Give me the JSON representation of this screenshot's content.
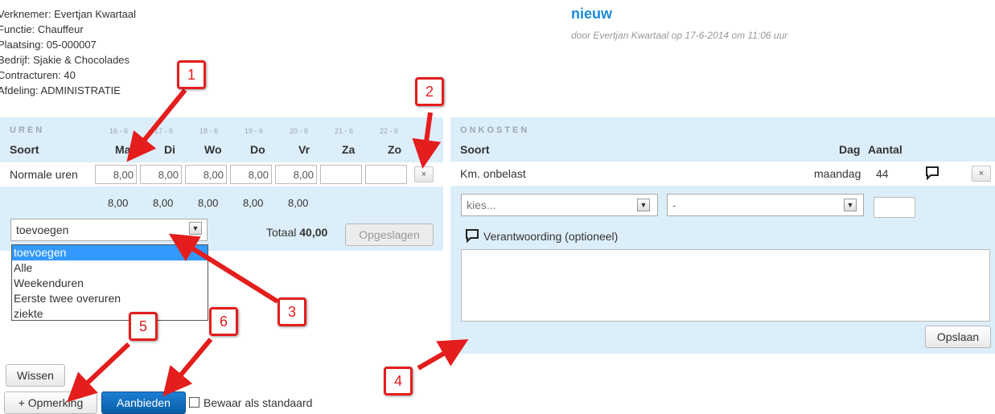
{
  "employee": {
    "werknemer": "Verknemer: Evertjan Kwartaal",
    "functie": "Functie: Chauffeur",
    "plaatsing": "Plaatsing: 05-000007",
    "bedrijf": "Bedrijf: Sjakie & Chocolades",
    "contracturen": "Contracturen: 40",
    "afdeling": "Afdeling: ADMINISTRATIE"
  },
  "header": {
    "title": "nieuw",
    "subtitle": "door Evertjan Kwartaal op 17-6-2014 om 11:06 uur"
  },
  "uren": {
    "section_label": "UREN",
    "soort_header": "Soort",
    "days": [
      {
        "date": "16 - 6",
        "label": "Ma"
      },
      {
        "date": "17 - 6",
        "label": "Di"
      },
      {
        "date": "18 - 6",
        "label": "Wo"
      },
      {
        "date": "19 - 6",
        "label": "Do"
      },
      {
        "date": "20 - 6",
        "label": "Vr"
      },
      {
        "date": "21 - 6",
        "label": "Za"
      },
      {
        "date": "22 - 6",
        "label": "Zo"
      }
    ],
    "row_label": "Normale uren",
    "row_values": [
      "8,00",
      "8,00",
      "8,00",
      "8,00",
      "8,00",
      "",
      ""
    ],
    "remove_label": "×",
    "day_totals": [
      "8,00",
      "8,00",
      "8,00",
      "8,00",
      "8,00"
    ],
    "add_select": "toevoegen",
    "totaal_label": "Totaal",
    "totaal_value": "40,00",
    "saved_button": "Opgeslagen",
    "dropdown_options": [
      "toevoegen",
      "Alle",
      "Weekenduren",
      "Eerste twee overuren",
      "ziekte"
    ]
  },
  "onkosten": {
    "section_label": "ONKOSTEN",
    "soort_header": "Soort",
    "dag_header": "Dag",
    "aantal_header": "Aantal",
    "row": {
      "soort": "Km. onbelast",
      "dag": "maandag",
      "aantal": "44"
    },
    "remove_label": "×",
    "select1": "kies...",
    "select2": "-",
    "verantwoording": "Verantwoording (optioneel)",
    "save_button": "Opslaan"
  },
  "actions": {
    "wissen": "Wissen",
    "opmerking": "+ Opmerking",
    "aanbieden": "Aanbieden",
    "bewaar": "Bewaar als standaard"
  },
  "annotations": [
    "1",
    "2",
    "3",
    "4",
    "5",
    "6"
  ],
  "colors": {
    "panel": "#dceefa",
    "accent": "#1a8ad8",
    "annotation": "#e41d1d"
  }
}
